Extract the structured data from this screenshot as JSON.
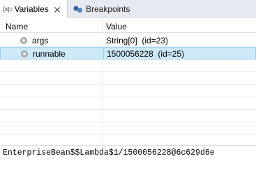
{
  "tabs": {
    "variables": {
      "icon_text": "(x)=",
      "label": "Variables"
    },
    "breakpoints": {
      "label": "Breakpoints"
    }
  },
  "columns": {
    "name": "Name",
    "value": "Value"
  },
  "variables": [
    {
      "name": "args",
      "value": "String[0]  (id=23)",
      "selected": false
    },
    {
      "name": "runnable",
      "value": "1500056228  (id=25)",
      "selected": true
    }
  ],
  "detail": {
    "text": "EnterpriseBean$$Lambda$1/1500056228@6c629d6e"
  },
  "colors": {
    "selection": "#cde8f7",
    "selection_border": "#99d1ef",
    "tabbar": "#e6eaf0",
    "field_icon": "#a8a8a8"
  },
  "icons": {
    "variables_tab": "variables-view-icon",
    "breakpoints_tab": "breakpoints-icon",
    "close": "close-icon",
    "field": "field-icon"
  }
}
